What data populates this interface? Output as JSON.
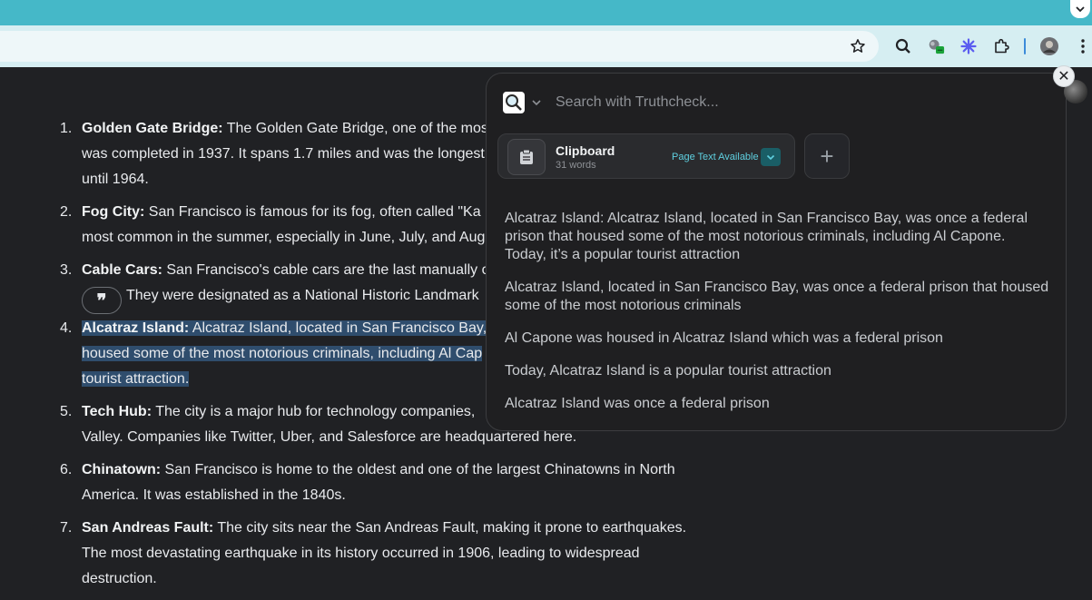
{
  "browser": {
    "omnibox_value": "",
    "icons": [
      "chevron-down-icon",
      "star-icon",
      "search-icon",
      "extension-badge-icon",
      "snowflake-icon",
      "puzzle-icon",
      "profile-avatar",
      "kebab-menu-icon"
    ]
  },
  "page": {
    "items": [
      {
        "num": "1.",
        "title": "Golden Gate Bridge:",
        "line1": " The Golden Gate Bridge, one of the mos",
        "line2": "was completed in 1937. It spans 1.7 miles and was the longest",
        "line3": "until 1964."
      },
      {
        "num": "2.",
        "title": "Fog City:",
        "line1": " San Francisco is famous for its fog, often called \"Ka",
        "line2": "most common in the summer, especially in June, July, and Aug"
      },
      {
        "num": "3.",
        "title": "Cable Cars:",
        "line1": " San Francisco's cable cars are the last manually o",
        "line2": "They were designated as a National Historic Landmark"
      },
      {
        "num": "4.",
        "title": "Alcatraz Island:",
        "line1": " Alcatraz Island, located in San Francisco Bay,",
        "line2": "housed some of the most notorious criminals, including Al Cap",
        "line3": "tourist attraction."
      },
      {
        "num": "5.",
        "title": "Tech Hub:",
        "line1": " The city is a major hub for technology companies,",
        "line2": "Valley. Companies like Twitter, Uber, and Salesforce are headquartered here."
      },
      {
        "num": "6.",
        "title": "Chinatown:",
        "line1": " San Francisco is home to the oldest and one of the largest Chinatowns in North",
        "line2": "America. It was established in the 1840s."
      },
      {
        "num": "7.",
        "title": "San Andreas Fault:",
        "line1": " The city sits near the San Andreas Fault, making it prone to earthquakes.",
        "line2": "The most devastating earthquake in its history occurred in 1906, leading to widespread",
        "line3": "destruction."
      }
    ],
    "quote_glyph": "❞"
  },
  "popup": {
    "close_glyph": "✕",
    "search_placeholder": "Search with Truthcheck...",
    "clipboard": {
      "title": "Clipboard",
      "subtitle": "31 words",
      "status": "Page Text Available"
    },
    "add_glyph": "+",
    "results": [
      "Alcatraz Island: Alcatraz Island, located in San Francisco Bay, was once a federal prison that housed some of the most notorious criminals, including Al Capone. Today, it’s a popular tourist attraction",
      "Alcatraz Island, located in San Francisco Bay, was once a federal prison that housed some of the most notorious criminals",
      "Al Capone was housed in Alcatraz Island which was a federal prison",
      "Today, Alcatraz Island is a popular tourist attraction",
      "Alcatraz Island was once a federal prison"
    ]
  },
  "colors": {
    "tabstrip": "#45b8c8",
    "toolbar": "#d6eef2",
    "page_bg": "#202124",
    "highlight": "#2f4d6d",
    "accent": "#5fd0e0"
  }
}
